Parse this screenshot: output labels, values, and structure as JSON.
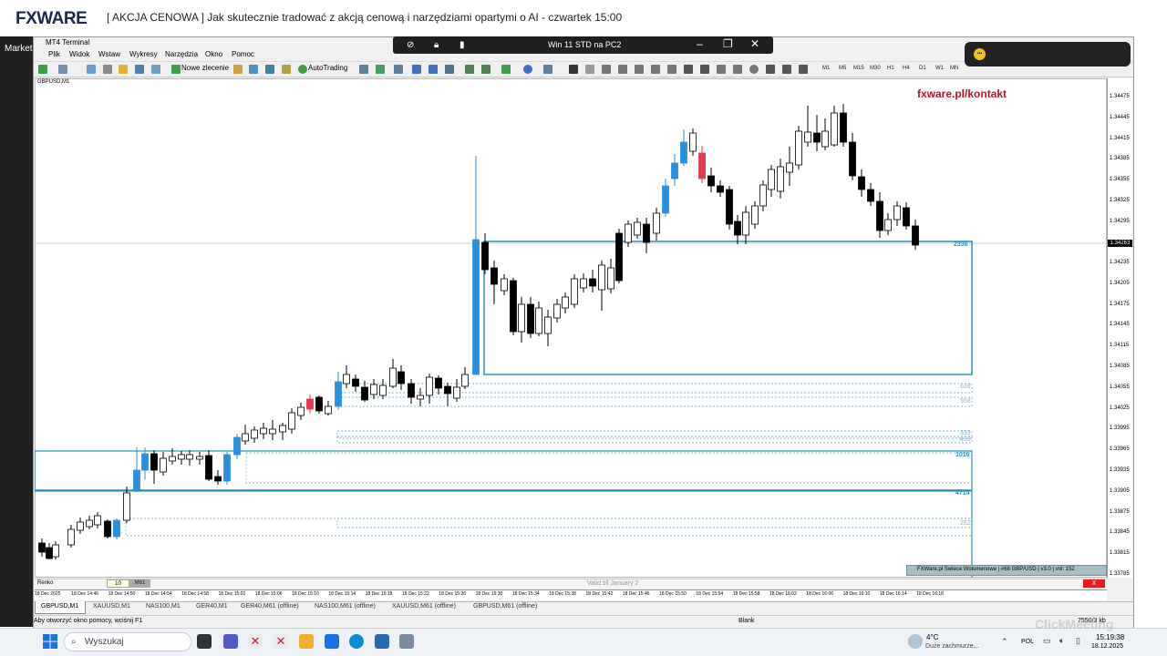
{
  "web": {
    "logo": "FXWARE",
    "title": "[ AKCJA CENOWA ] Jak skutecznie tradować z akcją cenową i narzędziami opartymi o AI - czwartek 15:00"
  },
  "left_panel": {
    "label": "Market Watch"
  },
  "mt4": {
    "window_title": "MT4 Terminal",
    "menu": [
      "Plik",
      "Widok",
      "Wstaw",
      "Wykresy",
      "Narzędzia",
      "Okno",
      "Pomoc"
    ],
    "toolbar": {
      "new_order": "Nowe zlecenie",
      "autotrading": "AutoTrading",
      "timeframes": [
        "M1",
        "M5",
        "M15",
        "M30",
        "H1",
        "H4",
        "D1",
        "W1",
        "MN"
      ]
    }
  },
  "remote": {
    "title": "Win 11 STD na PC2",
    "minimize": "–",
    "restore": "❐",
    "close": "✕"
  },
  "notification": {
    "dot": "•••"
  },
  "chart": {
    "symbol": "GBPUSD,M1",
    "brand": "fxware.pl/kontakt",
    "current_price": "1.34263",
    "price_ticks": [
      "1.34475",
      "1.34445",
      "1.34415",
      "1.34385",
      "1.34355",
      "1.34325",
      "1.34295",
      "1.34235",
      "1.34205",
      "1.34175",
      "1.34145",
      "1.34115",
      "1.34085",
      "1.34055",
      "1.34025",
      "1.33995",
      "1.33965",
      "1.33935",
      "1.33905",
      "1.33875",
      "1.33845",
      "1.33815",
      "1.33785"
    ],
    "zone_labels": [
      "2336",
      "639",
      "558",
      "333",
      "433",
      "1016",
      "4714",
      "262"
    ],
    "indicator": "FXWare.pl Swiece Wolumenowe | #68 GBP/USD | v3.0 | vol: 152",
    "time_ticks": [
      "18 Dec 2025",
      "18 Dec 14:46",
      "18 Dec 14:50",
      "18 Dec 14:54",
      "18 Dec 14:58",
      "18 Dec 15:02",
      "18 Dec 15:06",
      "18 Dec 15:10",
      "18 Dec 15:14",
      "18 Dec 15:18",
      "18 Dec 15:22",
      "18 Dec 15:26",
      "18 Dec 15:30",
      "18 Dec 15:34",
      "18 Dec 15:38",
      "18 Dec 15:42",
      "18 Dec 15:46",
      "18 Dec 15:50",
      "18 Dec 15:54",
      "18 Dec 15:58",
      "18 Dec 16:02",
      "18 Dec 16:06",
      "18 Dec 16:10",
      "18 Dec 16:14",
      "18 Dec 16:18"
    ]
  },
  "renko": {
    "label": "Renko",
    "value": "10",
    "tf": "M61",
    "valid": "Valid till January 2",
    "close": "X"
  },
  "tabs": [
    "GBPUSD,M1",
    "XAUUSD,M1",
    "NAS100,M1",
    "GER40,M1",
    "GER40,M61 (offline)",
    "NAS100,M61 (offline)",
    "XAUUSD,M61 (offline)",
    "GBPUSD,M61 (offline)"
  ],
  "status": {
    "help": "Aby otworzyć okno pomocy, wciśnij F1",
    "profile": "Blank",
    "traffic": "7550/3 kb"
  },
  "taskbar": {
    "search_placeholder": "Wyszukaj",
    "weather_temp": "4°C",
    "weather_text": "Duże zachmurze...",
    "lang": "POL",
    "time": "15:19:38",
    "date": "18.12.2025"
  },
  "watermark": "ClickMeeting",
  "colors": {
    "bull": "#2a8fe0",
    "bear": "#e23b4e",
    "zone": "#2a8fb8",
    "brand": "#c0102c"
  }
}
